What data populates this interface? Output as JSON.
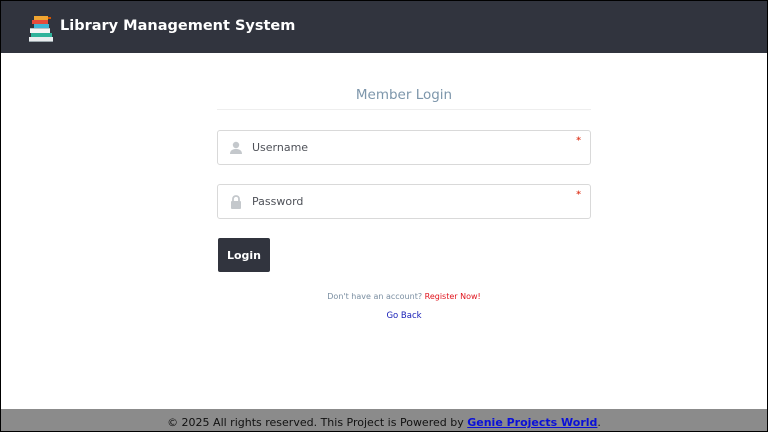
{
  "header": {
    "title": "Library Management System",
    "logo_icon": "books-stack-icon"
  },
  "login": {
    "title": "Member Login",
    "username": {
      "placeholder": "Username",
      "icon": "user-icon",
      "required_marker": "*"
    },
    "password": {
      "placeholder": "Password",
      "icon": "lock-icon",
      "required_marker": "*"
    },
    "submit_label": "Login",
    "register_prompt": "Don't have an account?",
    "register_link": "Register Now!",
    "go_back": "Go Back"
  },
  "footer": {
    "text": "© 2025 All rights reserved. This Project is Powered by ",
    "link": "Genie Projects World",
    "suffix": "."
  },
  "colors": {
    "header_bg": "#31343e",
    "button_bg": "#31343e",
    "title_text": "#7d96ab",
    "register_link": "#e0141d",
    "go_back_link": "#1a21b8",
    "footer_bg": "#8b8b8b",
    "footer_link": "#0a10d8"
  }
}
